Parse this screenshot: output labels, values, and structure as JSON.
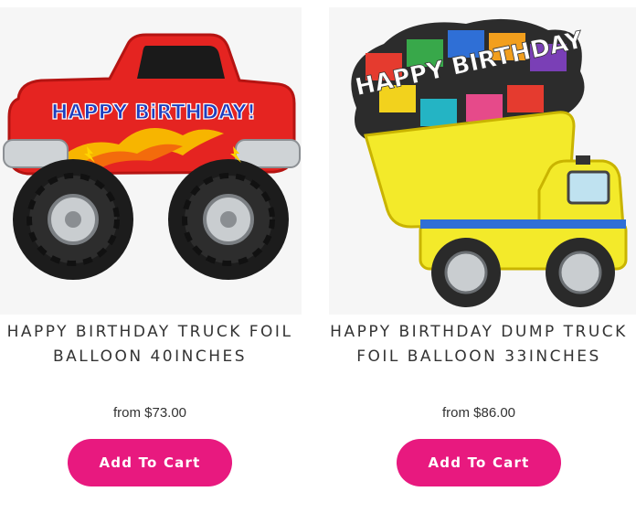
{
  "products": [
    {
      "title": "HAPPY BIRTHDAY TRUCK FOIL BALLOON 40INCHES",
      "price": "from $73.00",
      "button_label": "Add To Cart",
      "image_text": "HAPPY BiRTHDAY!",
      "icon": "monster-truck-balloon"
    },
    {
      "title": "HAPPY BIRTHDAY DUMP TRUCK FOIL BALLOON 33INCHES",
      "price": "from $86.00",
      "button_label": "Add To Cart",
      "image_text": "HAPPY BIRTHDAY",
      "icon": "dump-truck-balloon"
    }
  ],
  "colors": {
    "button": "#e8197f",
    "text": "#333333",
    "image_bg": "#f6f6f6"
  }
}
